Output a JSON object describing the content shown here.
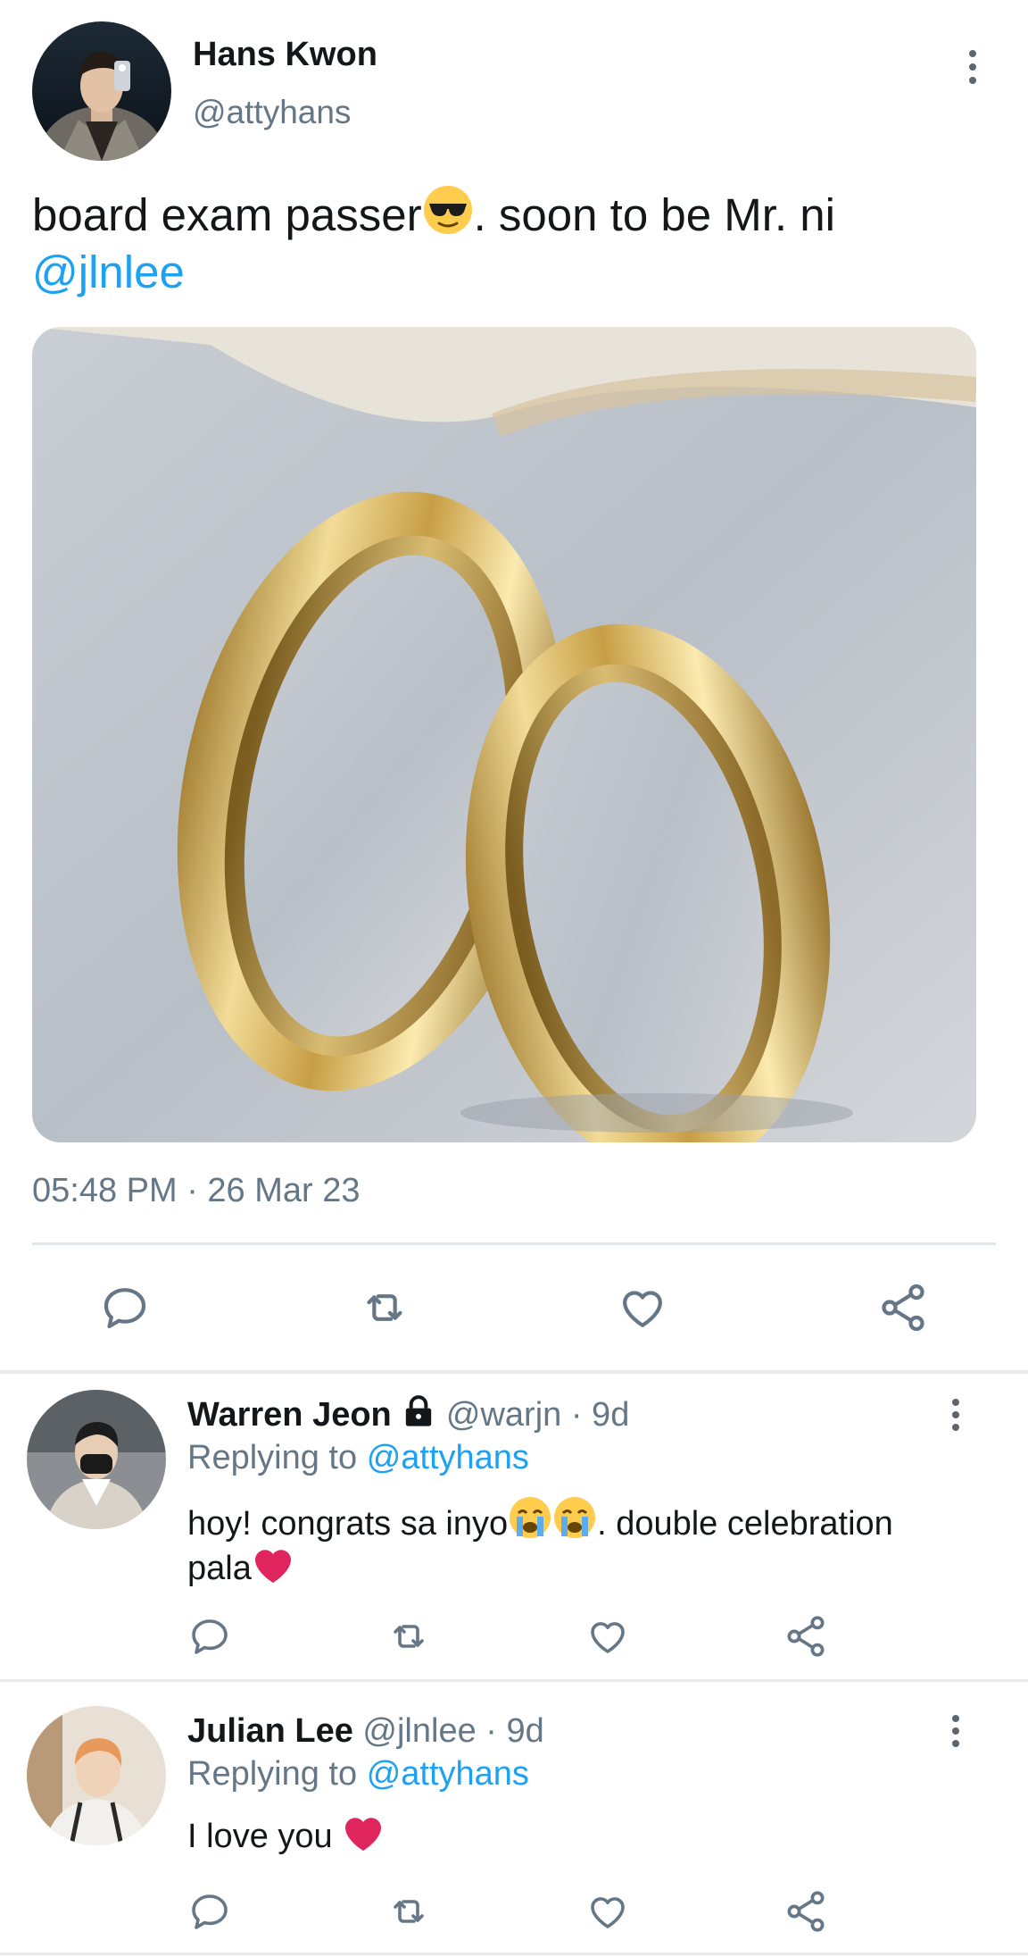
{
  "tweet": {
    "author_name": "Hans Kwon",
    "author_handle": "@attyhans",
    "text_prefix": "board exam passer",
    "text_middle": ". soon to be Mr. ni",
    "mention": "@jlnlee",
    "timestamp": "05:48 PM · 26 Mar 23",
    "emoji": "sunglasses-emoji",
    "image": "gold-wedding-rings-photo"
  },
  "replies": [
    {
      "name": "Warren Jeon",
      "locked": true,
      "handle": "@warjn",
      "age": "· 9d",
      "replying_label": "Replying to",
      "replying_to": "@attyhans",
      "text_a": "hoy! congrats sa inyo",
      "text_b": ". double celebration",
      "text_c": "pala"
    },
    {
      "name": "Julian Lee",
      "handle": "@jlnlee",
      "age": "· 9d",
      "replying_label": "Replying to",
      "replying_to": "@attyhans",
      "text_a": "I love you"
    }
  ],
  "colors": {
    "link": "#1da1f2",
    "muted": "#657786",
    "heart": "#e0245e",
    "icon": "#657786"
  }
}
